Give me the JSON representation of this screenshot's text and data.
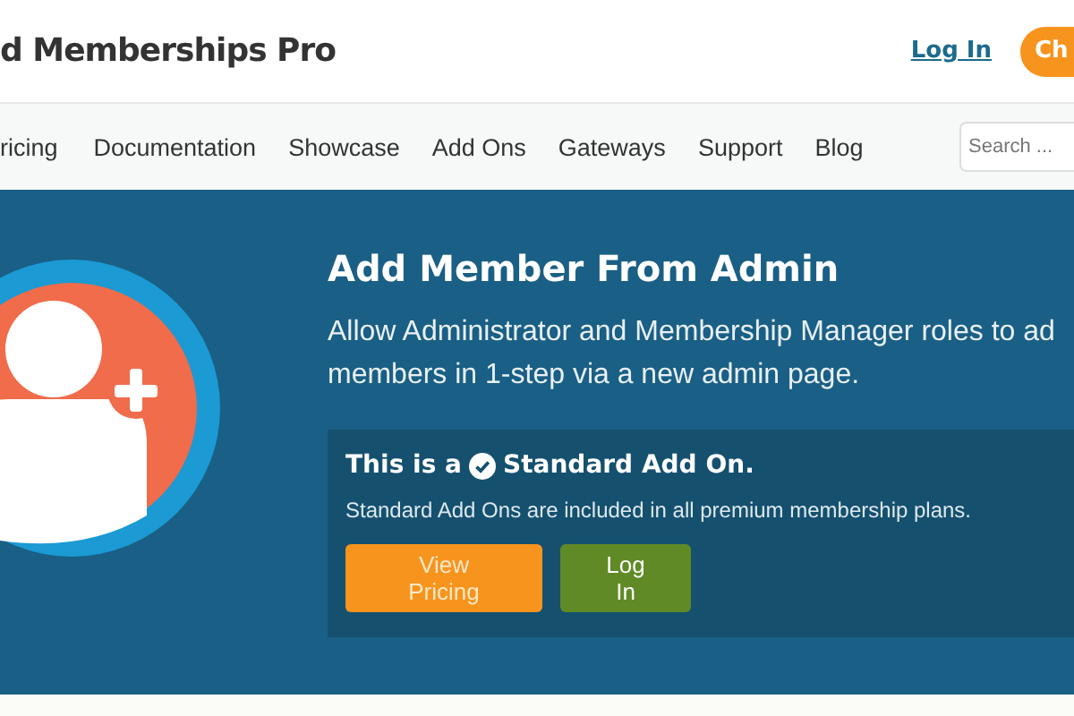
{
  "header": {
    "logo_text": "d Memberships Pro",
    "login_link": "Log In",
    "cta_button": "Ch"
  },
  "nav": {
    "items": [
      {
        "label": "ricing"
      },
      {
        "label": "Documentation"
      },
      {
        "label": "Showcase"
      },
      {
        "label": "Add Ons"
      },
      {
        "label": "Gateways"
      },
      {
        "label": "Support"
      },
      {
        "label": "Blog"
      }
    ],
    "search": {
      "placeholder": "Search ..."
    }
  },
  "hero": {
    "title": "Add Member From Admin",
    "description_lines": [
      "Allow Administrator and Membership Manager roles to ad",
      "members in 1-step via a new admin page."
    ],
    "card": {
      "heading_before": "This is a",
      "heading_after": "Standard Add On.",
      "text": "Standard Add Ons are included in all premium membership plans.",
      "buttons": [
        {
          "label": "View Pricing",
          "kind": "primary"
        },
        {
          "label": "Log In",
          "kind": "secondary"
        }
      ]
    }
  }
}
